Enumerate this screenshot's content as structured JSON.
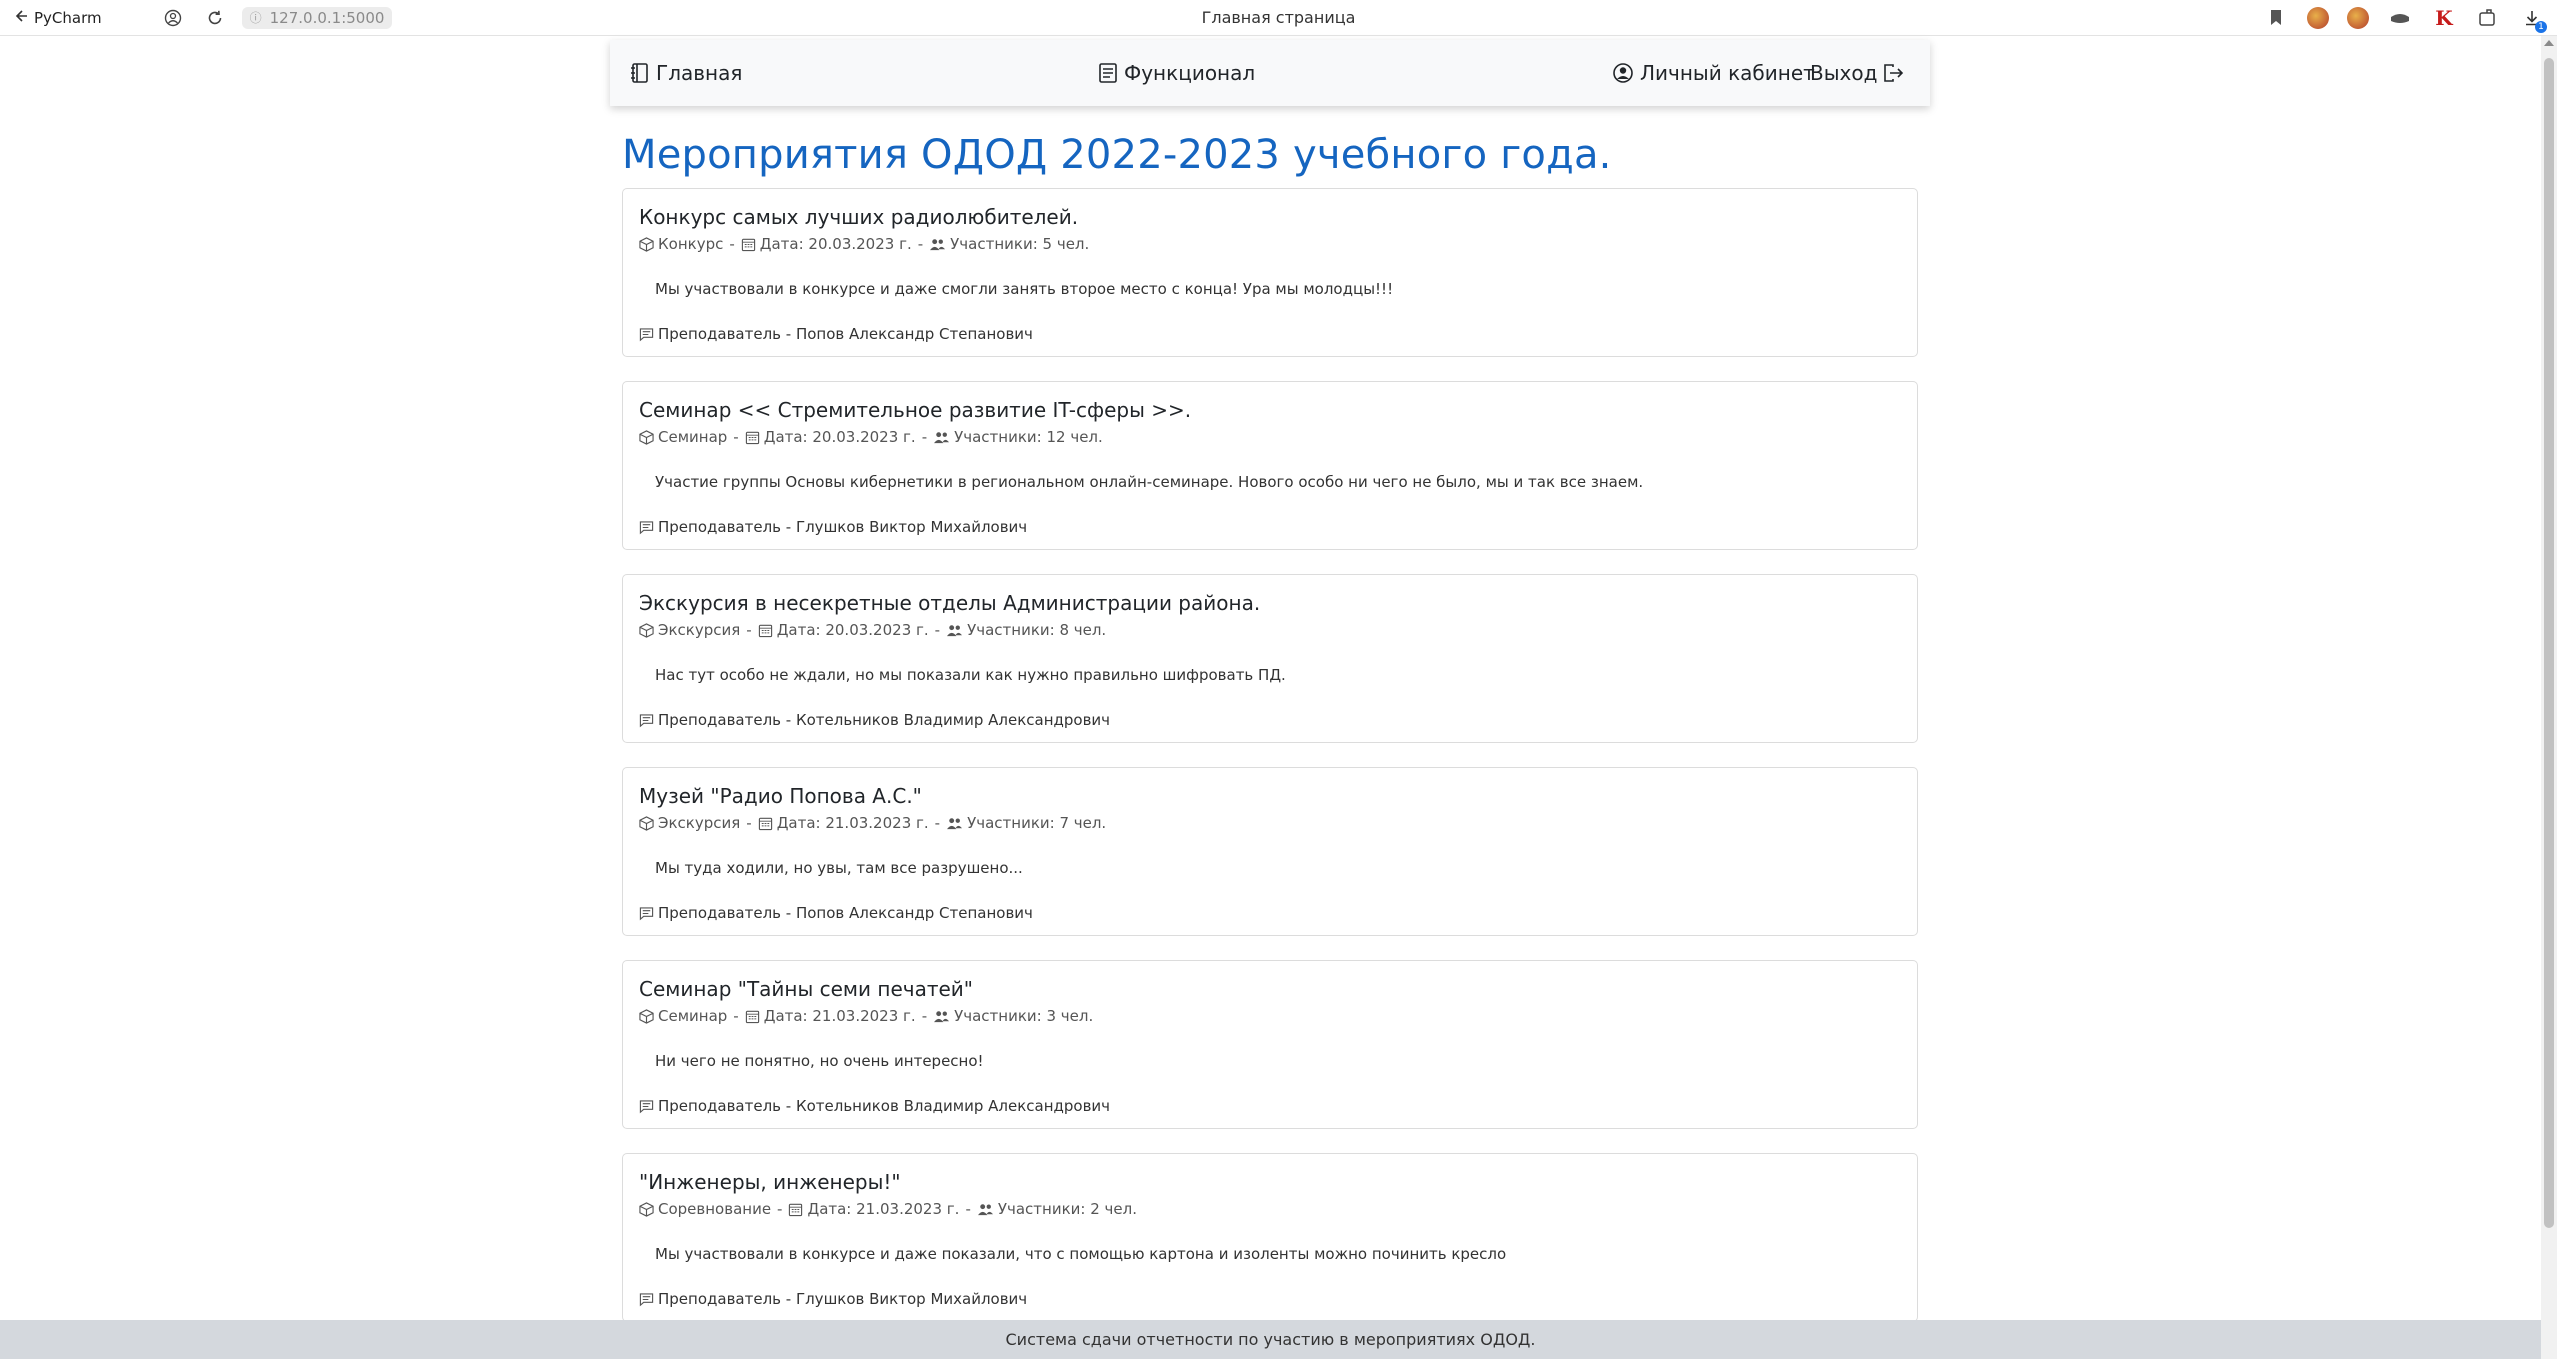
{
  "browser": {
    "back_label": "PyCharm",
    "url": "127.0.0.1:5000",
    "tab_title": "Главная страница",
    "download_badge": "1",
    "kaspersky_letter": "K"
  },
  "navbar": {
    "home": "Главная",
    "functional": "Функционал",
    "cabinet": "Личный кабинет",
    "exit": "Выход"
  },
  "page_title": "Мероприятия ОДОД 2022-2023 учебного года.",
  "events": [
    {
      "title": "Конкурс самых лучших радиолюбителей.",
      "type": "Конкурс",
      "date": "Дата: 20.03.2023 г.",
      "participants": "Участники: 5 чел.",
      "description": "Мы участвовали в конкурсе и даже смогли занять второе место с конца! Ура мы молодцы!!!",
      "teacher": "Преподаватель - Попов Александр Степанович"
    },
    {
      "title": "Семинар << Стремительное развитие IT-сферы >>.",
      "type": "Семинар",
      "date": "Дата: 20.03.2023 г.",
      "participants": "Участники: 12 чел.",
      "description": "Участие группы Основы кибернетики в региональном онлайн-семинаре. Нового особо ни чего не было, мы и так все знаем.",
      "teacher": "Преподаватель - Глушков Виктор Михайлович"
    },
    {
      "title": "Экскурсия в несекретные отделы Администрации района.",
      "type": "Экскурсия",
      "date": "Дата: 20.03.2023 г.",
      "participants": "Участники: 8 чел.",
      "description": "Нас тут особо не ждали, но мы показали как нужно правильно шифровать ПД.",
      "teacher": "Преподаватель - Котельников Владимир Александрович"
    },
    {
      "title": "Музей \"Радио Попова А.С.\"",
      "type": "Экскурсия",
      "date": "Дата: 21.03.2023 г.",
      "participants": "Участники: 7 чел.",
      "description": "Мы туда ходили, но увы, там все разрушено...",
      "teacher": "Преподаватель - Попов Александр Степанович"
    },
    {
      "title": "Семинар \"Тайны семи печатей\"",
      "type": "Семинар",
      "date": "Дата: 21.03.2023 г.",
      "participants": "Участники: 3 чел.",
      "description": "Ни чего не понятно, но очень интересно!",
      "teacher": "Преподаватель - Котельников Владимир Александрович"
    },
    {
      "title": "\"Инженеры, инженеры!\"",
      "type": "Соревнование",
      "date": "Дата: 21.03.2023 г.",
      "participants": "Участники: 2 чел.",
      "description": "Мы участвовали в конкурсе и даже показали, что с помощью картона и изоленты можно починить кресло",
      "teacher": "Преподаватель - Глушков Виктор Михайлович"
    }
  ],
  "footer": "Система сдачи отчетности по участию в мероприятиях ОДОД.",
  "colors": {
    "title": "#1565c0",
    "navbar_bg": "#f8f9fa",
    "footer_bg": "#d4d8dd",
    "card_border": "#dcdcdc"
  }
}
